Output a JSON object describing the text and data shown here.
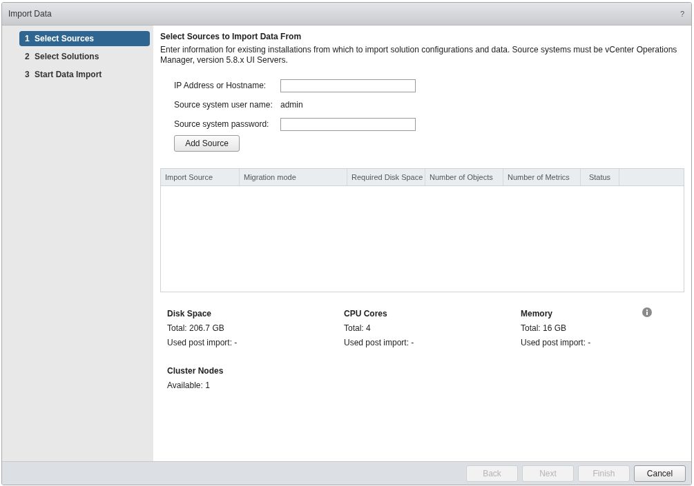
{
  "window": {
    "title": "Import Data",
    "help": "?"
  },
  "steps": [
    {
      "number": "1",
      "label": "Select Sources",
      "selected": true
    },
    {
      "number": "2",
      "label": "Select Solutions",
      "selected": false
    },
    {
      "number": "3",
      "label": "Start Data Import",
      "selected": false
    }
  ],
  "heading": "Select Sources to Import Data From",
  "description": "Enter information for existing installations from which to import solution configurations and data. Source systems must be vCenter Operations Manager, version 5.8.x UI Servers.",
  "form": [
    {
      "kind": "input",
      "label": "IP Address or Hostname:"
    },
    {
      "kind": "text",
      "label": "Source system user name:",
      "value": "admin"
    },
    {
      "kind": "input",
      "label": "Source system password:"
    }
  ],
  "add_button": "Add Source",
  "table": {
    "columns": [
      "Import Source",
      "Migration mode",
      "Required Disk Space",
      "Number of Objects",
      "Number of Metrics",
      "Status"
    ]
  },
  "stats": [
    {
      "title": "Disk Space",
      "lines": [
        "Total: 206.7 GB",
        "Used post import: -"
      ]
    },
    {
      "title": "CPU Cores",
      "lines": [
        "Total: 4",
        "Used post import: -"
      ]
    },
    {
      "title": "Memory",
      "lines": [
        "Total: 16 GB",
        "Used post import: -"
      ]
    }
  ],
  "cluster": {
    "title": "Cluster Nodes",
    "lines": [
      "Available: 1"
    ]
  },
  "buttons": [
    {
      "label": "Back",
      "disabled": true
    },
    {
      "label": "Next",
      "disabled": true
    },
    {
      "label": "Finish",
      "disabled": true
    },
    {
      "label": "Cancel",
      "disabled": false
    }
  ]
}
